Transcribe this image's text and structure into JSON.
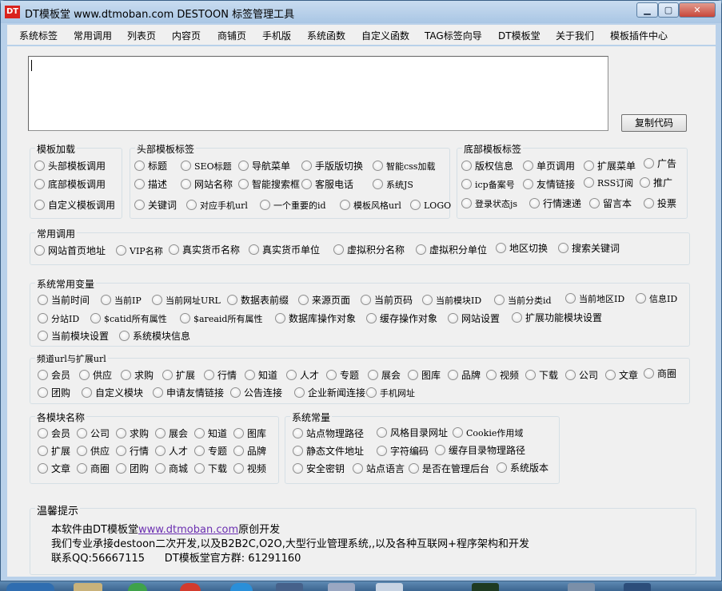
{
  "window": {
    "title": "DT模板堂 www.dtmoban.com DESTOON 标签管理工具",
    "icon_text": "DT"
  },
  "caption_buttons": {
    "minimize": "▁",
    "maximize": "▢",
    "close": "✕"
  },
  "menu": [
    "系统标签",
    "常用调用",
    "列表页",
    "内容页",
    "商铺页",
    "手机版",
    "系统函数",
    "自定义函数",
    "TAG标签向导",
    "DT模板堂",
    "关于我们",
    "模板插件中心"
  ],
  "code_area": {
    "value": ""
  },
  "copy_button": "复制代码",
  "groups": {
    "template_load": {
      "title": "模板加载",
      "items": [
        "头部模板调用",
        "底部模板调用",
        "自定义模板调用"
      ]
    },
    "header_tags": {
      "title": "头部模板标签",
      "items": [
        "标题",
        "SEO标题",
        "导航菜单",
        "手版版切换",
        "智能css加载",
        "描述",
        "网站名称",
        "智能搜索框",
        "客服电话",
        "系统JS",
        "关键词",
        "对应手机url",
        "一个重要的id",
        "模板风格url",
        "LOGO"
      ]
    },
    "footer_tags": {
      "title": "底部模板标签",
      "items": [
        "版权信息",
        "单页调用",
        "扩展菜单",
        "广告",
        "icp备案号",
        "友情链接",
        "RSS订阅",
        "推广",
        "登录状态js",
        "行情速递",
        "留言本",
        "投票"
      ]
    },
    "common_calls": {
      "title": "常用调用",
      "items": [
        "网站首页地址",
        "VIP名称",
        "真实货币名称",
        "真实货币单位",
        "虚拟积分名称",
        "虚拟积分单位",
        "地区切换",
        "搜索关键词"
      ]
    },
    "system_vars": {
      "title": "系统常用变量",
      "items": [
        "当前时间",
        "当前IP",
        "当前网址URL",
        "数据表前缀",
        "来源页面",
        "当前页码",
        "当前模块ID",
        "当前分类id",
        "当前地区ID",
        "信息ID",
        "分站ID",
        "$catid所有属性",
        "$areaid所有属性",
        "数据库操作对象",
        "缓存操作对象",
        "网站设置",
        "扩展功能模块设置",
        "当前模块设置",
        "系统模块信息"
      ]
    },
    "channel_urls": {
      "title": "频道url与扩展url",
      "items": [
        "会员",
        "供应",
        "求购",
        "扩展",
        "行情",
        "知道",
        "人才",
        "专题",
        "展会",
        "图库",
        "品牌",
        "视频",
        "下载",
        "公司",
        "文章",
        "商圈",
        "团购",
        "自定义模块",
        "申请友情链接",
        "公告连接",
        "企业新闻连接",
        "手机网址"
      ]
    },
    "module_names": {
      "title": "各模块名称",
      "items": [
        "会员",
        "公司",
        "求购",
        "展会",
        "知道",
        "图库",
        "扩展",
        "供应",
        "行情",
        "人才",
        "专题",
        "品牌",
        "文章",
        "商圈",
        "团购",
        "商城",
        "下载",
        "视频"
      ]
    },
    "system_consts": {
      "title": "系统常量",
      "items": [
        "站点物理路径",
        "风格目录网址",
        "Cookie作用域",
        "静态文件地址",
        "字符编码",
        "缓存目录物理路径",
        "安全密钥",
        "站点语言",
        "是否在管理后台",
        "系统版本"
      ]
    }
  },
  "tips": {
    "title": "温馨提示",
    "line1_pre": "本软件由DT模板堂",
    "line1_link": "www.dtmoban.com",
    "line1_post": "原创开发",
    "line2": "我们专业承接destoon二次开发,以及B2B2C,O2O,大型行业管理系统,,以及各种互联网+程序架构和开发",
    "line3": "联系QQ:56667115      DT模板堂官方群: 61291160"
  },
  "taskbar_icons": [
    "start-orb-icon",
    "folder-icon",
    "browser-icon",
    "media-icon",
    "chat-icon",
    "shield-icon",
    "app-icon",
    "window-icon",
    "terminal-icon",
    "window-icon-2",
    "window-icon-3"
  ]
}
